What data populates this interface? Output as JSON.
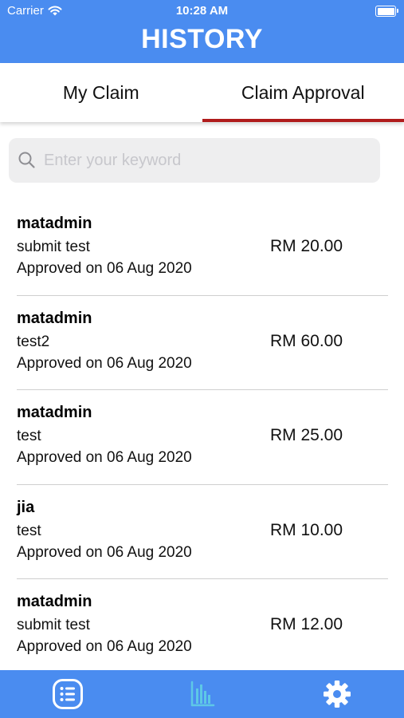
{
  "status_bar": {
    "carrier": "Carrier",
    "time": "10:28 AM"
  },
  "header": {
    "title": "HISTORY"
  },
  "tabs": [
    {
      "label": "My Claim",
      "active": false
    },
    {
      "label": "Claim Approval",
      "active": true
    }
  ],
  "search": {
    "placeholder": "Enter your keyword",
    "value": ""
  },
  "claims": [
    {
      "name": "matadmin",
      "description": "submit test",
      "status": "Approved on 06 Aug 2020",
      "amount": "RM 20.00"
    },
    {
      "name": "matadmin",
      "description": "test2",
      "status": "Approved on 06 Aug 2020",
      "amount": "RM 60.00"
    },
    {
      "name": "matadmin",
      "description": "test",
      "status": "Approved on 06 Aug 2020",
      "amount": "RM 25.00"
    },
    {
      "name": "jia",
      "description": "test",
      "status": "Approved on 06 Aug 2020",
      "amount": "RM 10.00"
    },
    {
      "name": "matadmin",
      "description": "submit test",
      "status": "Approved on 06 Aug 2020",
      "amount": "RM 12.00"
    }
  ],
  "bottom_nav": [
    {
      "icon": "list-icon",
      "active": false
    },
    {
      "icon": "bar-chart-icon",
      "active": true
    },
    {
      "icon": "gear-icon",
      "active": false
    }
  ],
  "colors": {
    "primary": "#4a8cf0",
    "tab_indicator": "#b01c1c",
    "active_icon": "#5ec8e6"
  }
}
